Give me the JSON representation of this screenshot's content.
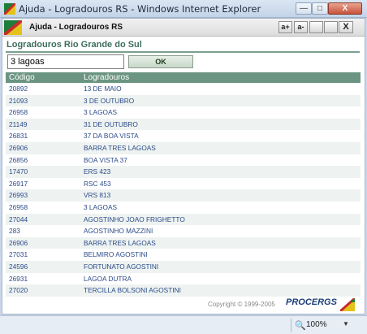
{
  "window": {
    "title": "Ajuda - Logradouros RS - Windows Internet Explorer",
    "minimize": "—",
    "maximize": "□",
    "close": "X"
  },
  "app_header": {
    "title": "Ajuda - Logradouros RS",
    "font_increase": "a+",
    "font_decrease": "a-",
    "blank1": "",
    "blank2": "",
    "close": "X"
  },
  "page": {
    "title": "Logradouros Rio Grande do Sul"
  },
  "search": {
    "value": "3 lagoas",
    "button": "OK"
  },
  "table": {
    "headers": [
      "Código",
      "Logradouros"
    ],
    "rows": [
      [
        "20892",
        "13 DE MAIO"
      ],
      [
        "21093",
        "3 DE OUTUBRO"
      ],
      [
        "26958",
        "3 LAGOAS"
      ],
      [
        "21149",
        "31 DE OUTUBRO"
      ],
      [
        "26831",
        "37 DA BOA VISTA"
      ],
      [
        "26906",
        "BARRA TRES LAGOAS"
      ],
      [
        "26856",
        "BOA VISTA 37"
      ],
      [
        "17470",
        "ERS 423"
      ],
      [
        "26917",
        "RSC 453"
      ],
      [
        "26993",
        "VRS 813"
      ],
      [
        "26958",
        "3 LAGOAS"
      ],
      [
        "27044",
        "AGOSTINHO JOAO FRIGHETTO"
      ],
      [
        "283",
        "AGOSTINHO MAZZINI"
      ],
      [
        "26906",
        "BARRA TRES LAGOAS"
      ],
      [
        "27031",
        "BELMIRO AGOSTINI"
      ],
      [
        "24596",
        "FORTUNATO AGOSTINI"
      ],
      [
        "26931",
        "LAGOA DUTRA"
      ],
      [
        "27020",
        "TERCILLA BOLSONI AGOSTINI"
      ]
    ]
  },
  "footer": {
    "copyright": "Copyright © 1999-2005",
    "brand": "PROCERGS"
  },
  "statusbar": {
    "zoom": "100%"
  }
}
